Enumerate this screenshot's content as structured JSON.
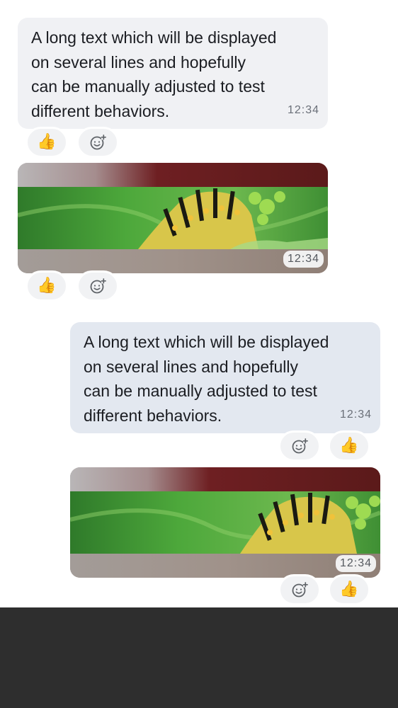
{
  "messages": [
    {
      "direction": "incoming",
      "type": "text",
      "text": "A long text which will be displayed\non several lines and hopefully\ncan be manually adjusted to test\ndifferent behaviors.",
      "timestamp": "12:34",
      "reactions": {
        "reaction_emoji": "👍",
        "add_reaction_icon": "smiley-plus-icon"
      }
    },
    {
      "direction": "incoming",
      "type": "image",
      "image_subject": "caterpillar",
      "timestamp": "12:34",
      "reactions": {
        "reaction_emoji": "👍",
        "add_reaction_icon": "smiley-plus-icon"
      }
    },
    {
      "direction": "outgoing",
      "type": "text",
      "text": "A long text which will be displayed\non several lines and hopefully\ncan be manually adjusted to test\ndifferent behaviors.",
      "timestamp": "12:34",
      "reactions": {
        "reaction_emoji": "👍",
        "add_reaction_icon": "smiley-plus-icon"
      }
    },
    {
      "direction": "outgoing",
      "type": "image",
      "image_subject": "caterpillar",
      "timestamp": "12:34",
      "reactions": {
        "reaction_emoji": "👍",
        "add_reaction_icon": "smiley-plus-icon"
      }
    }
  ],
  "colors": {
    "incoming_bubble": "#f0f1f4",
    "outgoing_bubble": "#e3e8f0",
    "bottom_area": "#2e2e2e"
  }
}
